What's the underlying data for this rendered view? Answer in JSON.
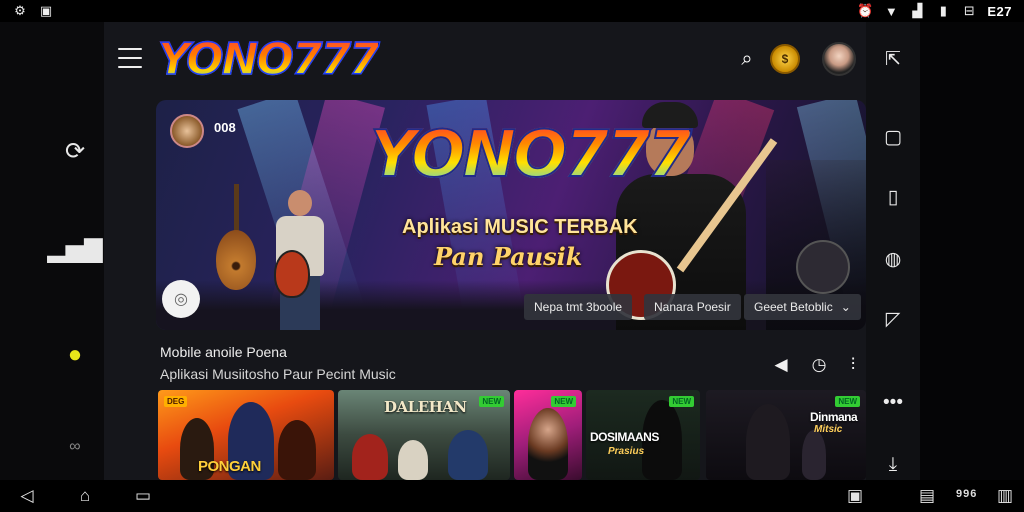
{
  "status_bar": {
    "time": "E27",
    "left_icons": [
      "settings-gear-icon",
      "notification-icon"
    ],
    "right_icons": [
      "alarm-icon",
      "wifi-icon",
      "signal-icon",
      "battery-icon",
      "bag-icon"
    ]
  },
  "left_rail": {
    "items": [
      "refresh-icon",
      "stats-icon",
      "bulb-icon",
      "loop-icon"
    ]
  },
  "header": {
    "logo": "YONO777",
    "icons": [
      "search-icon",
      "coin-icon",
      "avatar"
    ]
  },
  "hero": {
    "corner_label": "008",
    "logo": "YONO777",
    "subtitle_1": "Aplikasi MUSIC TERBAK",
    "subtitle_2": "Pan Pausik",
    "chips": [
      "Nepa tmt 3boole",
      "Nanara Poesir",
      "Geeet Betoblic"
    ]
  },
  "section": {
    "title": "Mobile anoile Poena",
    "subtitle": "Aplikasi Musiitosho Paur Pecint Music"
  },
  "cards": [
    {
      "title": "PONGAN",
      "tag": "DEG"
    },
    {
      "title": "DALEHAN",
      "tag": "NEW"
    },
    {
      "title": "",
      "tag": "NEW"
    },
    {
      "title": "DOSIMAANS",
      "sub": "Prasius",
      "tag": "NEW"
    },
    {
      "title": "Dinmana",
      "sub": "Mitsic",
      "tag": "NEW"
    }
  ],
  "right_rail": {
    "items": [
      "share-icon",
      "square-icon",
      "bookmark-icon",
      "compass-icon",
      "message-icon",
      "more-icon",
      "collapse-icon"
    ]
  },
  "nav_bar": {
    "text": "996"
  },
  "colors": {
    "app_bg": "#15161b",
    "chip_bg": "#32343c",
    "tag_green": "#33cc33"
  }
}
